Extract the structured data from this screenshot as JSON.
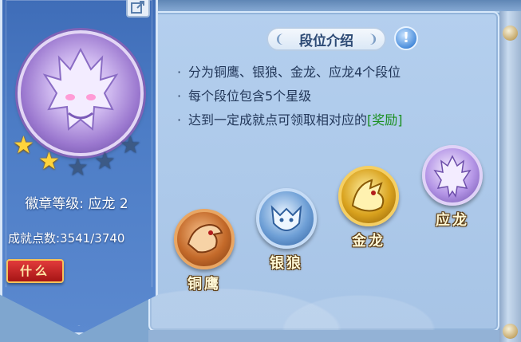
{
  "badge": {
    "stars": [
      true,
      true,
      false,
      false,
      false
    ],
    "level_text": "徽章等级: 应龙 2",
    "achievement_text": "成就点数:3541/3740",
    "what_button_label": "什么"
  },
  "panel": {
    "title": "段位介绍",
    "rules": [
      {
        "text": "分为铜鹰、银狼、金龙、应龙4个段位",
        "reward": ""
      },
      {
        "text": "每个段位包含5个星级",
        "reward": ""
      },
      {
        "text": "达到一定成就点可领取相对应的",
        "reward": "[奖励]"
      }
    ],
    "tiers": [
      {
        "name": "铜鹰",
        "icon": "eagle-icon",
        "color": "#c46a2a"
      },
      {
        "name": "银狼",
        "icon": "wolf-icon",
        "color": "#6e9fd6"
      },
      {
        "name": "金龙",
        "icon": "dragon-icon",
        "color": "#d9a21e"
      },
      {
        "name": "应龙",
        "icon": "winged-dragon-icon",
        "color": "#b495e6"
      }
    ]
  },
  "colors": {
    "reward_text": "#1a8f1f",
    "panel_bg": "#b4cfee",
    "card_bg": "#4d7dc6"
  }
}
